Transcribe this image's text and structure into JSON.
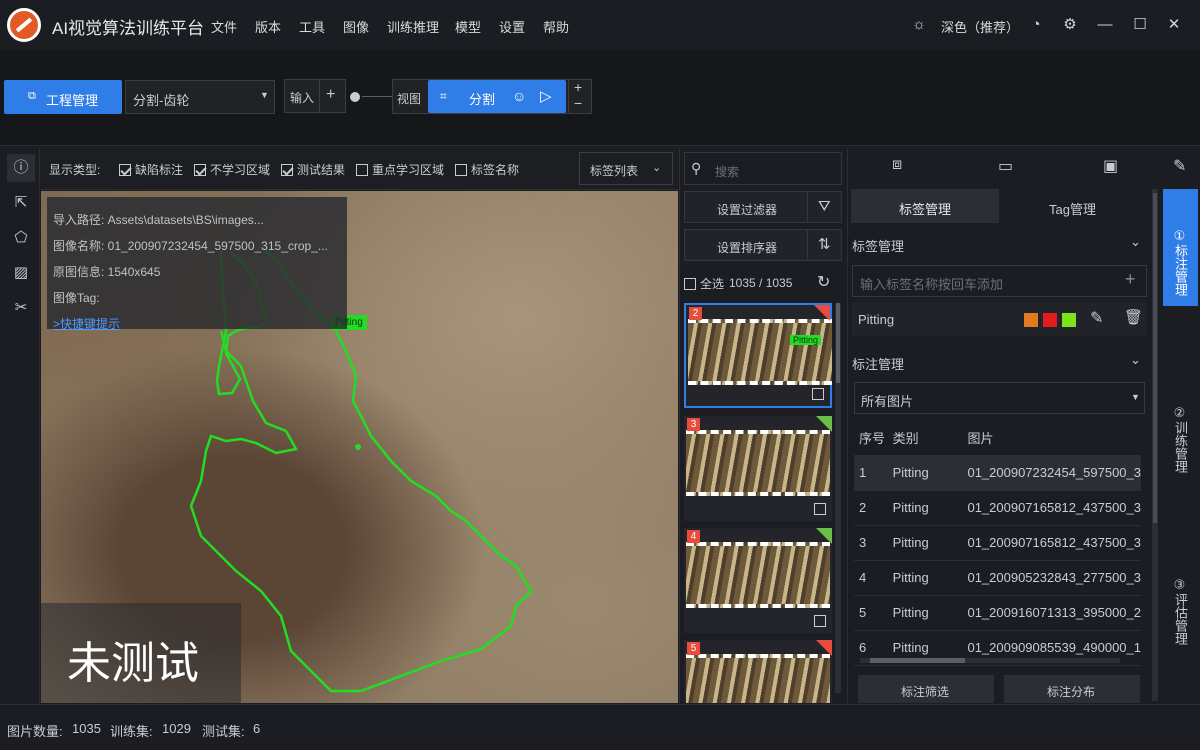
{
  "app": {
    "title": "AI视觉算法训练平台"
  },
  "menu": [
    "文件",
    "版本",
    "工具",
    "图像",
    "训练推理",
    "模型",
    "设置",
    "帮助"
  ],
  "theme": {
    "label": "深色（推荐）"
  },
  "toolbar": {
    "project_btn": "工程管理",
    "project_select": "分割-齿轮",
    "input_label": "输入",
    "view_label": "视图",
    "seg_label": "分割",
    "plus": "+",
    "minus": "−"
  },
  "filterbar": {
    "display_type": "显示类型:",
    "options": [
      {
        "label": "缺陷标注",
        "checked": true
      },
      {
        "label": "不学习区域",
        "checked": true
      },
      {
        "label": "测试结果",
        "checked": true
      },
      {
        "label": "重点学习区域",
        "checked": false
      },
      {
        "label": "标签名称",
        "checked": false
      }
    ],
    "tag_list": "标签列表"
  },
  "info": {
    "path": "导入路径:   Assets\\datasets\\BS\\images...",
    "name": "图像名称:   01_200907232454_597500_315_crop_...",
    "original": "原图信息:   1540x645",
    "tag": "图像Tag:",
    "shortcut": ">快捷键提示"
  },
  "canvas": {
    "label": "Pitting",
    "status": "未测试"
  },
  "listpanel": {
    "search_placeholder": "搜索",
    "filter_btn": "设置过滤器",
    "sort_btn": "设置排序器",
    "select_all": "全选",
    "count": "1035 / 1035",
    "thumbs": [
      {
        "num": "2",
        "corner": "red",
        "label": "Pitting"
      },
      {
        "num": "3",
        "corner": "green",
        "label": ""
      },
      {
        "num": "4",
        "corner": "green",
        "label": ""
      },
      {
        "num": "5",
        "corner": "red",
        "label": ""
      }
    ]
  },
  "rightpanel": {
    "tabs": [
      "标签管理",
      "Tag管理"
    ],
    "label_mgmt_title": "标签管理",
    "add_placeholder": "输入标签名称按回车添加",
    "label_name": "Pitting",
    "label_colors": [
      "#e07b22",
      "#e21b1b",
      "#7be21b"
    ],
    "anno_title": "标注管理",
    "anno_filter": "所有图片",
    "table_headers": [
      "序号",
      "类别",
      "图片"
    ],
    "rows": [
      {
        "idx": "1",
        "cls": "Pitting",
        "img": "01_200907232454_597500_3"
      },
      {
        "idx": "2",
        "cls": "Pitting",
        "img": "01_200907165812_437500_3"
      },
      {
        "idx": "3",
        "cls": "Pitting",
        "img": "01_200907165812_437500_3"
      },
      {
        "idx": "4",
        "cls": "Pitting",
        "img": "01_200905232843_277500_3"
      },
      {
        "idx": "5",
        "cls": "Pitting",
        "img": "01_200916071313_395000_2"
      },
      {
        "idx": "6",
        "cls": "Pitting",
        "img": "01_200909085539_490000_1"
      }
    ],
    "btn_filter": "标注筛选",
    "btn_dist": "标注分布"
  },
  "vtabs": [
    "①标注管理",
    "②训练管理",
    "③评估管理"
  ],
  "status": {
    "images_label": "图片数量:",
    "images": "1035",
    "train_label": "训练集:",
    "train": "1029",
    "test_label": "测试集:",
    "test": "6"
  }
}
